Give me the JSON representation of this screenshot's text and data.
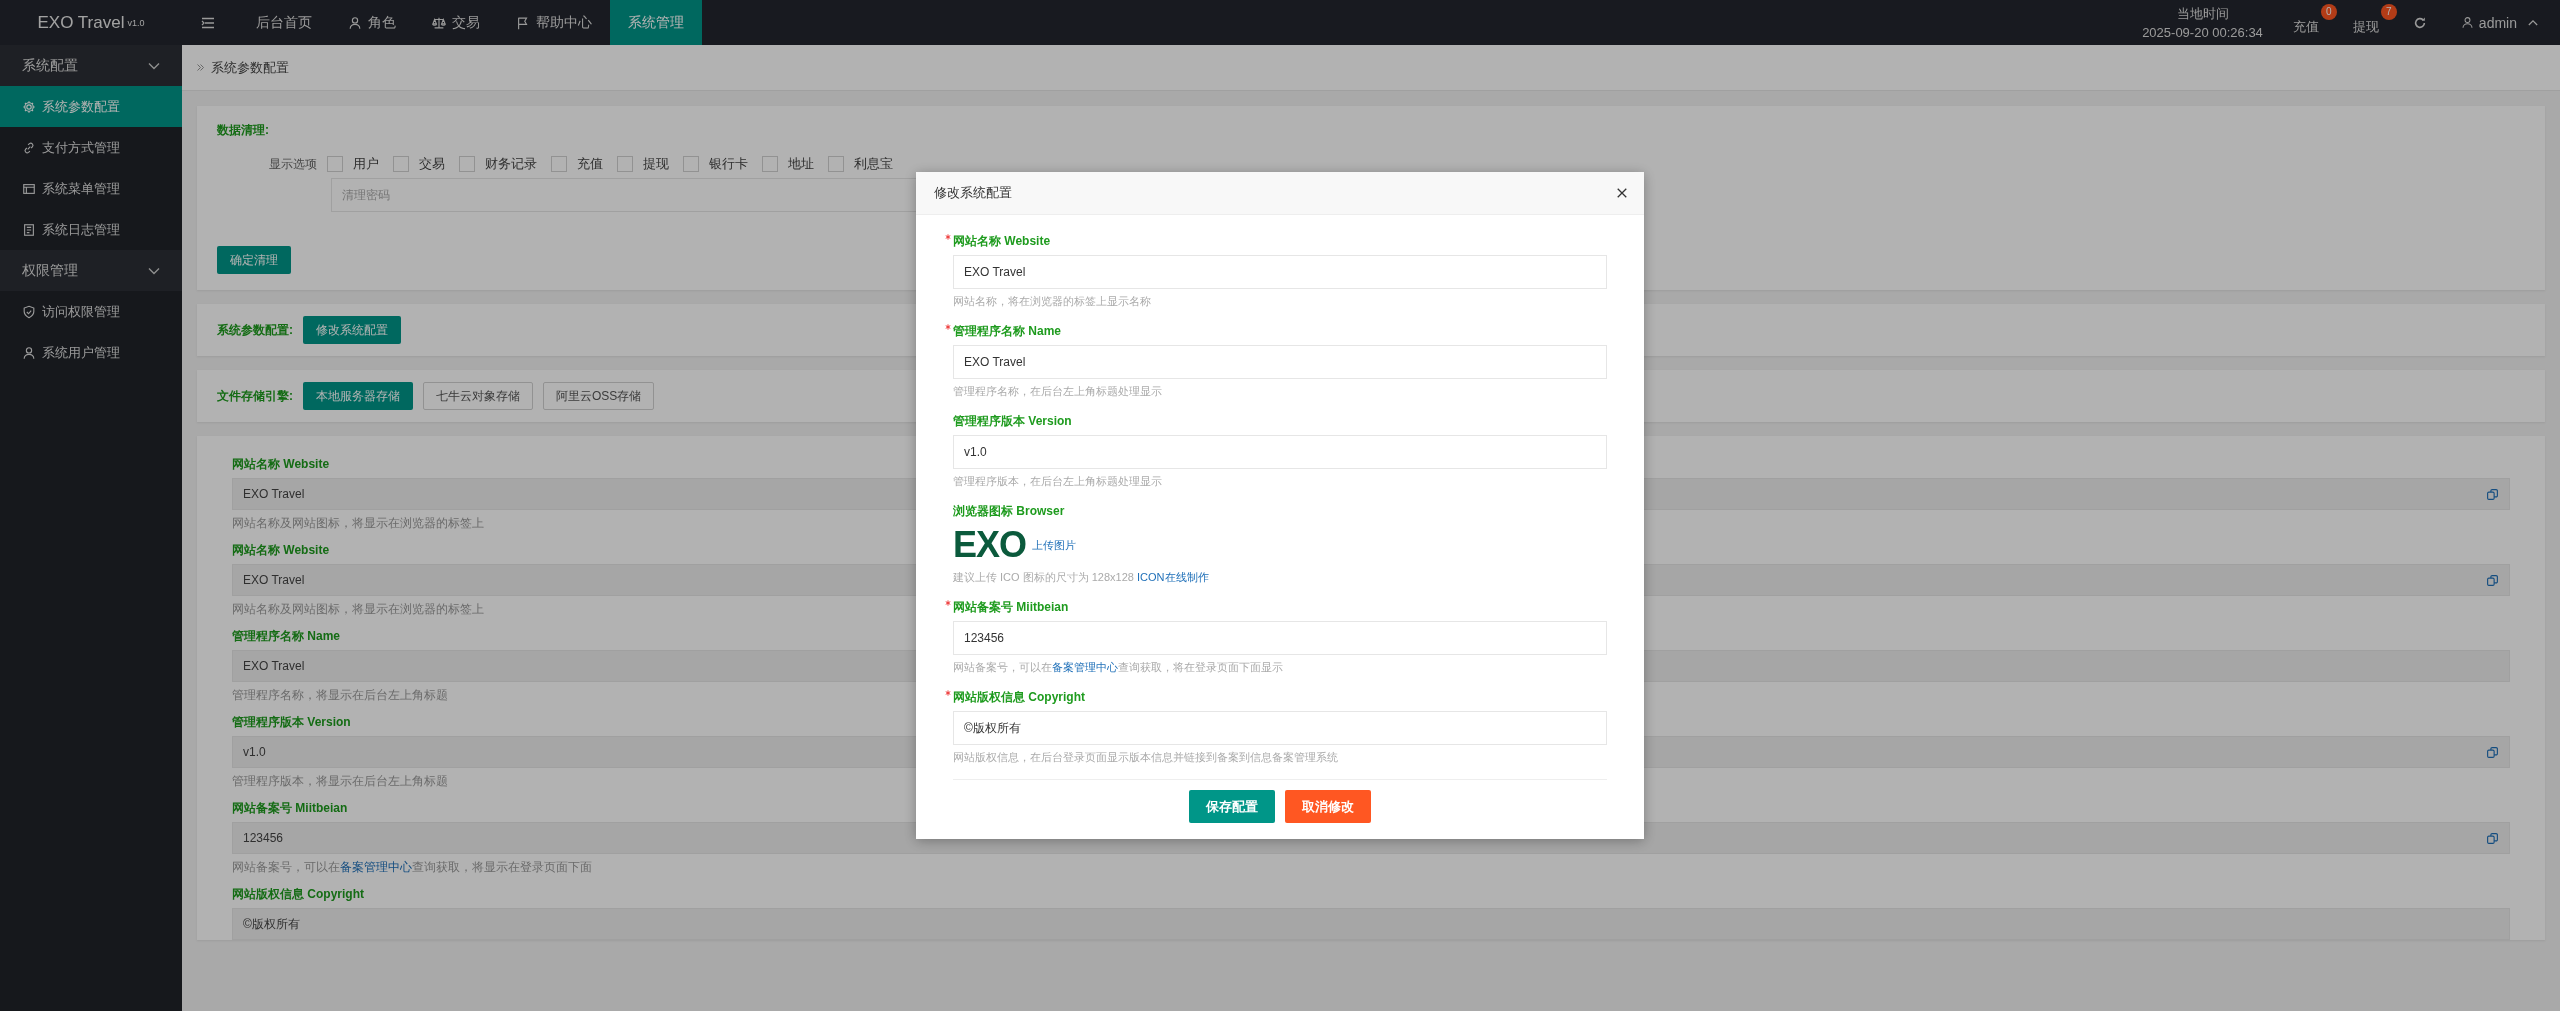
{
  "app": {
    "name": "EXO Travel",
    "version": "v1.0"
  },
  "top_nav": [
    {
      "label": "后台首页",
      "selected": false
    },
    {
      "label": "角色",
      "selected": false
    },
    {
      "label": "交易",
      "selected": false
    },
    {
      "label": "帮助中心",
      "selected": false
    },
    {
      "label": "系统管理",
      "selected": true
    }
  ],
  "clock": {
    "label": "当地时间",
    "value": "2025-09-20 00:26:34"
  },
  "header_actions": [
    {
      "label": "充值",
      "badge": "0"
    },
    {
      "label": "提现",
      "badge": "7"
    }
  ],
  "user": {
    "name": "admin"
  },
  "sidebar": [
    {
      "label": "系统配置",
      "expanded": true,
      "children": [
        {
          "label": "系统参数配置",
          "selected": true
        },
        {
          "label": "支付方式管理",
          "selected": false
        },
        {
          "label": "系统菜单管理",
          "selected": false
        },
        {
          "label": "系统日志管理",
          "selected": false
        }
      ]
    },
    {
      "label": "权限管理",
      "expanded": true,
      "children": [
        {
          "label": "访问权限管理",
          "selected": false
        },
        {
          "label": "系统用户管理",
          "selected": false
        }
      ]
    }
  ],
  "breadcrumb": "系统参数配置",
  "data_cleanup": {
    "title": "数据清理:",
    "options_label": "显示选项",
    "options": [
      {
        "label": "用户",
        "checked": false
      },
      {
        "label": "交易",
        "checked": false
      },
      {
        "label": "财务记录",
        "checked": false
      },
      {
        "label": "充值",
        "checked": false
      },
      {
        "label": "提现",
        "checked": false
      },
      {
        "label": "银行卡",
        "checked": false
      },
      {
        "label": "地址",
        "checked": false
      },
      {
        "label": "利息宝",
        "checked": false
      }
    ],
    "password_placeholder": "清理密码",
    "button": "确定清理"
  },
  "system_config": {
    "title": "系统参数配置:",
    "button": "修改系统配置"
  },
  "storage": {
    "title": "文件存储引擎:",
    "engines": [
      {
        "label": "本地服务器存储",
        "selected": true
      },
      {
        "label": "七牛云对象存储",
        "selected": false
      },
      {
        "label": "阿里云OSS存储",
        "selected": false
      }
    ]
  },
  "settings_list": [
    {
      "label": "网站名称 Website",
      "value": "EXO Travel",
      "copyable": true,
      "hint": "网站名称及网站图标，将显示在浏览器的标签上"
    },
    {
      "label": "网站名称 Website",
      "value": "EXO Travel",
      "copyable": true,
      "hint": "网站名称及网站图标，将显示在浏览器的标签上"
    },
    {
      "label": "管理程序名称 Name",
      "value": "EXO Travel",
      "copyable": false,
      "hint": "管理程序名称，将显示在后台左上角标题"
    },
    {
      "label": "管理程序版本 Version",
      "value": "v1.0",
      "copyable": true,
      "hint": "管理程序版本，将显示在后台左上角标题"
    },
    {
      "label": "网站备案号 Miitbeian",
      "value": "123456",
      "copyable": true,
      "hint": "网站备案号，可以在",
      "hint_link": "备案管理中心",
      "hint_after": "查询获取，将显示在登录页面下面"
    },
    {
      "label": "网站版权信息 Copyright",
      "value": "©版权所有",
      "copyable": false
    }
  ],
  "modal": {
    "title": "修改系统配置",
    "fields": [
      {
        "kind": "input",
        "required": true,
        "label": "网站名称 Website",
        "value": "EXO Travel",
        "hint": "网站名称，将在浏览器的标签上显示名称"
      },
      {
        "kind": "input",
        "required": true,
        "label": "管理程序名称 Name",
        "value": "EXO Travel",
        "hint": "管理程序名称，在后台左上角标题处理显示"
      },
      {
        "kind": "input",
        "required": false,
        "label": "管理程序版本 Version",
        "value": "v1.0",
        "hint": "管理程序版本，在后台左上角标题处理显示"
      },
      {
        "kind": "image",
        "required": false,
        "label": "浏览器图标 Browser",
        "logo": "EXO",
        "upload": "上传图片",
        "hint": "建议上传 ICO 图标的尺寸为 128x128 ",
        "hint_link": "ICON在线制作"
      },
      {
        "kind": "input",
        "required": true,
        "label": "网站备案号 Miitbeian",
        "value": "123456",
        "hint": "网站备案号，可以在",
        "hint_link": "备案管理中心",
        "hint_after": "查询获取，将在登录页面下面显示"
      },
      {
        "kind": "input",
        "required": true,
        "label": "网站版权信息 Copyright",
        "value": "©版权所有",
        "hint": "网站版权信息，在后台登录页面显示版本信息并链接到备案到信息备案管理系统"
      }
    ],
    "buttons": [
      {
        "label": "保存配置",
        "kind": "primary"
      },
      {
        "label": "取消修改",
        "kind": "danger"
      }
    ]
  }
}
